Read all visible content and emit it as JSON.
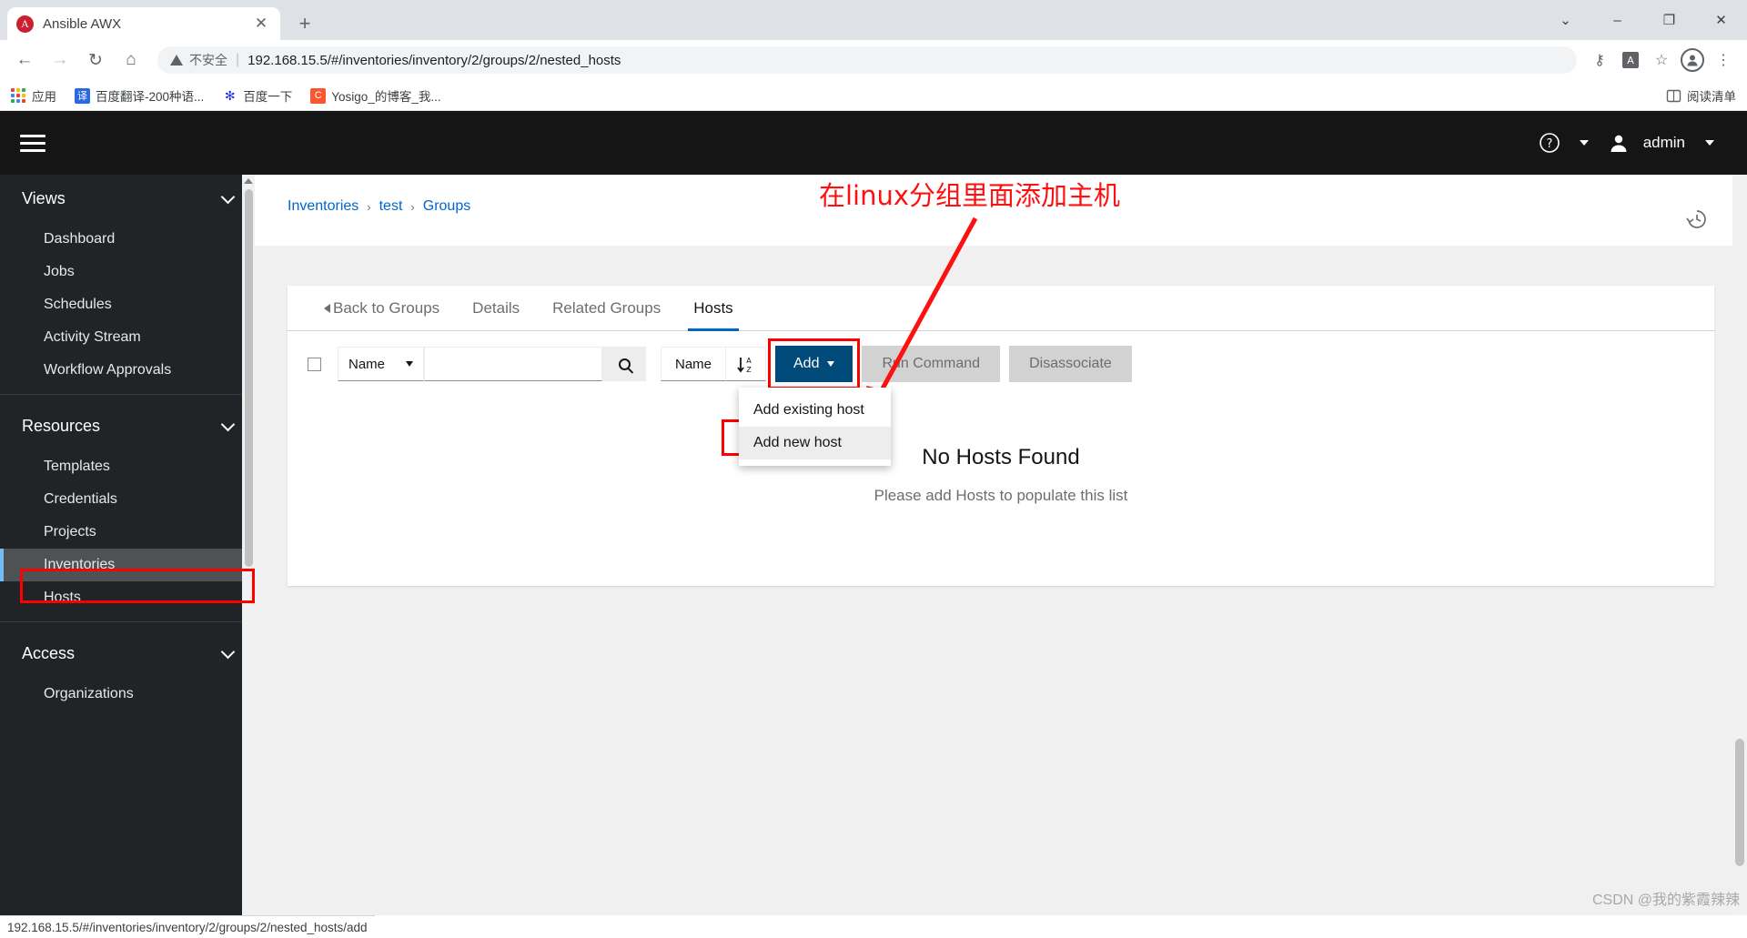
{
  "browser": {
    "tab": {
      "title": "Ansible AWX",
      "favicon_letter": "A",
      "close_label": "✕"
    },
    "new_tab_label": "+",
    "window_controls": {
      "minimize": "–",
      "maximize": "❐",
      "close": "✕",
      "more": "⌄"
    },
    "nav": {
      "back": "←",
      "forward": "→",
      "reload": "↻",
      "home": "⌂"
    },
    "omnibox": {
      "security_label": "不安全",
      "separator": "|",
      "url": "192.168.15.5/#/inventories/inventory/2/groups/2/nested_hosts"
    },
    "toolbar_right": {
      "key_icon": "⚷",
      "translate_icon": "译",
      "star_icon": "☆",
      "profile_icon": "●",
      "menu_icon": "⋮"
    },
    "bookmarks": [
      {
        "label": "应用",
        "icon": "apps-grid-icon",
        "color": "#4285f4"
      },
      {
        "label": "百度翻译-200种语...",
        "icon": "translate-icon",
        "color": "#2a6ae0",
        "glyph": "译"
      },
      {
        "label": "百度一下",
        "icon": "baidu-icon",
        "color": "#2932e1",
        "glyph": "✻"
      },
      {
        "label": "Yosigo_的博客_我...",
        "icon": "csdn-icon",
        "color": "#fc5531",
        "glyph": "C"
      }
    ],
    "reading_list": {
      "label": "阅读清单",
      "icon": "reading-list-icon"
    },
    "status_bar_url": "192.168.15.5/#/inventories/inventory/2/groups/2/nested_hosts/add"
  },
  "app": {
    "header": {
      "menu_icon": "hamburger-icon",
      "help_icon": "?",
      "help_caret": "▾",
      "user_icon": "user-icon",
      "user_name": "admin",
      "user_caret": "▾"
    },
    "sidebar": {
      "sections": [
        {
          "title": "Views",
          "items": [
            {
              "label": "Dashboard",
              "active": false
            },
            {
              "label": "Jobs",
              "active": false
            },
            {
              "label": "Schedules",
              "active": false
            },
            {
              "label": "Activity Stream",
              "active": false
            },
            {
              "label": "Workflow Approvals",
              "active": false
            }
          ]
        },
        {
          "title": "Resources",
          "items": [
            {
              "label": "Templates",
              "active": false
            },
            {
              "label": "Credentials",
              "active": false
            },
            {
              "label": "Projects",
              "active": false
            },
            {
              "label": "Inventories",
              "active": true
            },
            {
              "label": "Hosts",
              "active": false
            }
          ]
        },
        {
          "title": "Access",
          "items": [
            {
              "label": "Organizations",
              "active": false
            }
          ]
        }
      ]
    },
    "breadcrumb": {
      "items": [
        "Inventories",
        "test",
        "Groups"
      ],
      "separator": "›"
    },
    "history_icon": "history-icon",
    "tabs": [
      {
        "label": "Back to Groups",
        "active": false,
        "has_back_caret": true
      },
      {
        "label": "Details",
        "active": false,
        "has_back_caret": false
      },
      {
        "label": "Related Groups",
        "active": false,
        "has_back_caret": false
      },
      {
        "label": "Hosts",
        "active": true,
        "has_back_caret": false
      }
    ],
    "toolbar": {
      "select_all_checkbox": "",
      "filter_key": "Name",
      "filter_value": "",
      "filter_placeholder": "",
      "search_icon": "search-icon",
      "sort_key": "Name",
      "sort_icon": "sort-alpha-icon",
      "add_button": "Add",
      "add_caret": "▾",
      "run_command_button": "Run Command",
      "disassociate_button": "Disassociate"
    },
    "dropdown": {
      "items": [
        {
          "label": "Add existing host",
          "hovered": false
        },
        {
          "label": "Add new host",
          "hovered": true
        }
      ]
    },
    "empty_state": {
      "title": "No Hosts Found",
      "subtitle": "Please add Hosts to populate this list"
    }
  },
  "annotations": {
    "note_text": "在linux分组里面添加主机",
    "note_color": "#ff1010",
    "highlight_color": "#ff0000"
  },
  "watermark": {
    "text": "CSDN @我的紫霞辣辣"
  }
}
